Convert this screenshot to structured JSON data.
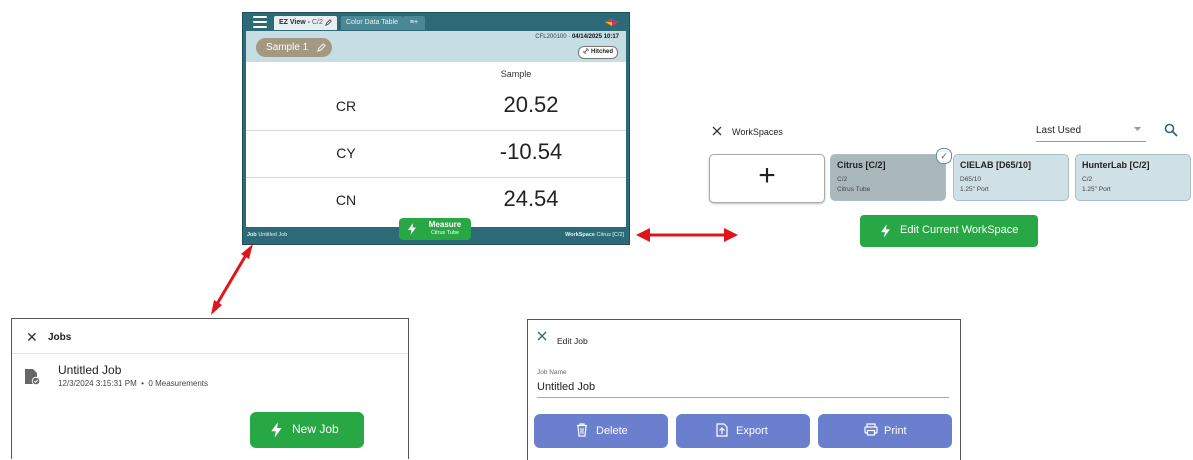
{
  "device": {
    "tabs": {
      "ez_view": "EZ View -",
      "ez_view_sub": "C/2",
      "color_data": "Color Data Table",
      "add": "≡+"
    },
    "sample_name": "Sample 1",
    "device_id": "CFL200100 ·",
    "datetime": "04/14/2025 10:17",
    "hitched": "Hitched",
    "column_header": "Sample",
    "rows": [
      {
        "label": "CR",
        "value": "20.52"
      },
      {
        "label": "CY",
        "value": "-10.54"
      },
      {
        "label": "CN",
        "value": "24.54"
      }
    ],
    "status": {
      "job_label": "Job",
      "job_value": "Untitled Job",
      "workspace_label": "WorkSpace",
      "workspace_value": "Citrus [C/2]"
    },
    "measure": {
      "label": "Measure",
      "sub": "Citrus Tube"
    }
  },
  "workspaces": {
    "title": "WorkSpaces",
    "sort": "Last Used",
    "add_label": "+",
    "cards": [
      {
        "name": "Citrus [C/2]",
        "meta1": "C/2",
        "meta2": "Citrus Tube"
      },
      {
        "name": "CIELAB [D65/10]",
        "meta1": "D65/10",
        "meta2": "1.25\" Port"
      },
      {
        "name": "HunterLab [C/2]",
        "meta1": "C/2",
        "meta2": "1.25\" Port"
      }
    ],
    "check": "✓",
    "edit_button": "Edit Current WorkSpace"
  },
  "jobs": {
    "close": "✕",
    "title": "Jobs",
    "items": [
      {
        "name": "Untitled Job",
        "meta": "12/3/2024 3:15:31 PM  •  0 Measurements"
      }
    ],
    "new_job": "New Job"
  },
  "edit_job": {
    "close": "✕",
    "title": "Edit Job",
    "field_label": "Job Name",
    "field_value": "Untitled Job",
    "buttons": {
      "delete": "Delete",
      "export": "Export",
      "print": "Print"
    }
  },
  "colors": {
    "accent_teal": "#2d6a78",
    "green": "#28a745",
    "button_blue": "#6b7fcf",
    "arrow_red": "#e0141b"
  }
}
